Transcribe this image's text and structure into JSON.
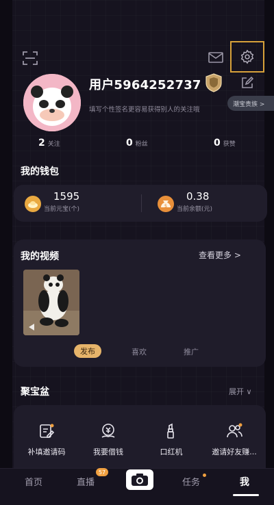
{
  "colors": {
    "background": "#16131f",
    "card": "#1f1c2a",
    "accent": "#e6b46a",
    "highlight_border": "#d8a23a"
  },
  "header": {
    "icons": [
      "scan-icon",
      "mail-icon",
      "settings-icon",
      "edit-icon"
    ]
  },
  "profile": {
    "username": "用户5964252737",
    "bio": "填写个性签名更容易获得别人的关注哦",
    "vip_chip": "潮宝贵族 >"
  },
  "stats": [
    {
      "value": "2",
      "label": "关注"
    },
    {
      "value": "0",
      "label": "粉丝"
    },
    {
      "value": "0",
      "label": "获赞"
    }
  ],
  "wallet": {
    "title": "我的钱包",
    "items": [
      {
        "value": "1595",
        "label": "当前元宝(个)",
        "icon": "gold-ingot-icon"
      },
      {
        "value": "0.38",
        "label": "当前余额(元)",
        "icon": "money-bag-icon"
      }
    ]
  },
  "videos": {
    "title": "我的视频",
    "more": "查看更多 >",
    "tabs": [
      "发布",
      "喜欢",
      "推广"
    ],
    "active_tab": "发布"
  },
  "treasure": {
    "title": "聚宝盆",
    "expand": "展开 ∨",
    "tools": [
      {
        "label": "补填邀请码",
        "icon": "invite-code-icon"
      },
      {
        "label": "我要借钱",
        "icon": "loan-icon"
      },
      {
        "label": "口红机",
        "icon": "lipstick-icon"
      },
      {
        "label": "邀请好友赚...",
        "icon": "invite-friends-icon"
      }
    ]
  },
  "tabbar": {
    "items": [
      "首页",
      "直播",
      "任务",
      "我"
    ],
    "live_badge": "57",
    "active": "我"
  }
}
